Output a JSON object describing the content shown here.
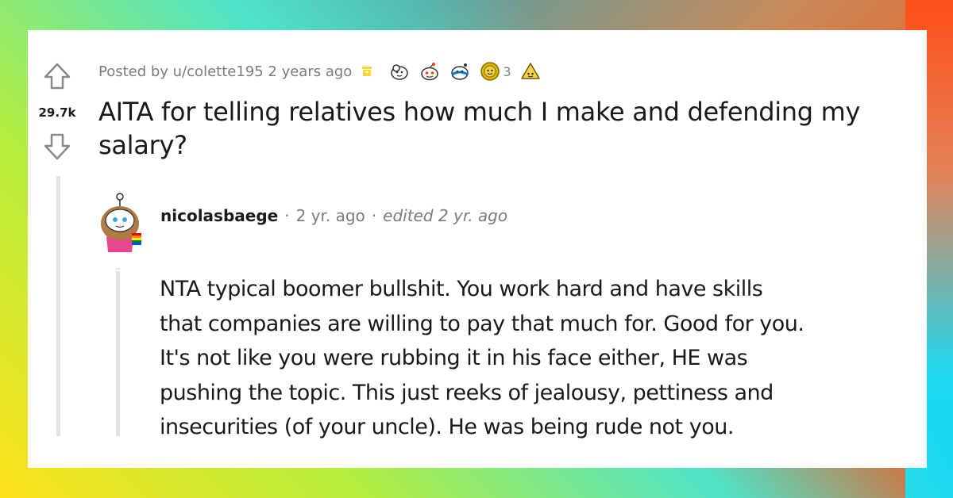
{
  "post": {
    "posted_by": "Posted by u/colette195 2 years ago",
    "award_count": "3",
    "vote_count": "29.7k",
    "title": "AITA for telling relatives how much I make and defending my salary?",
    "awards": [
      "wholesome-award-icon",
      "snoo-award-icon",
      "hugz-award-icon",
      "gold-award-icon",
      "helpful-award-icon"
    ]
  },
  "comment": {
    "author": "nicolasbaege",
    "age": "2 yr. ago",
    "edited": "edited 2 yr. ago",
    "separator": "·",
    "body_lines": [
      "NTA typical boomer bullshit. You work hard and have skills",
      "that companies are willing to pay that much for. Good for you.",
      "It's not like you were rubbing it in his face either, HE was",
      "pushing the topic. This just reeks of jealousy, pettiness and",
      "insecurities (of your uncle). He was being rude not you."
    ]
  },
  "colors": {
    "text": "#1a1a1b",
    "meta": "#7c7c7c",
    "archive": "#ffd635",
    "thread_line": "#e3e3e3"
  }
}
